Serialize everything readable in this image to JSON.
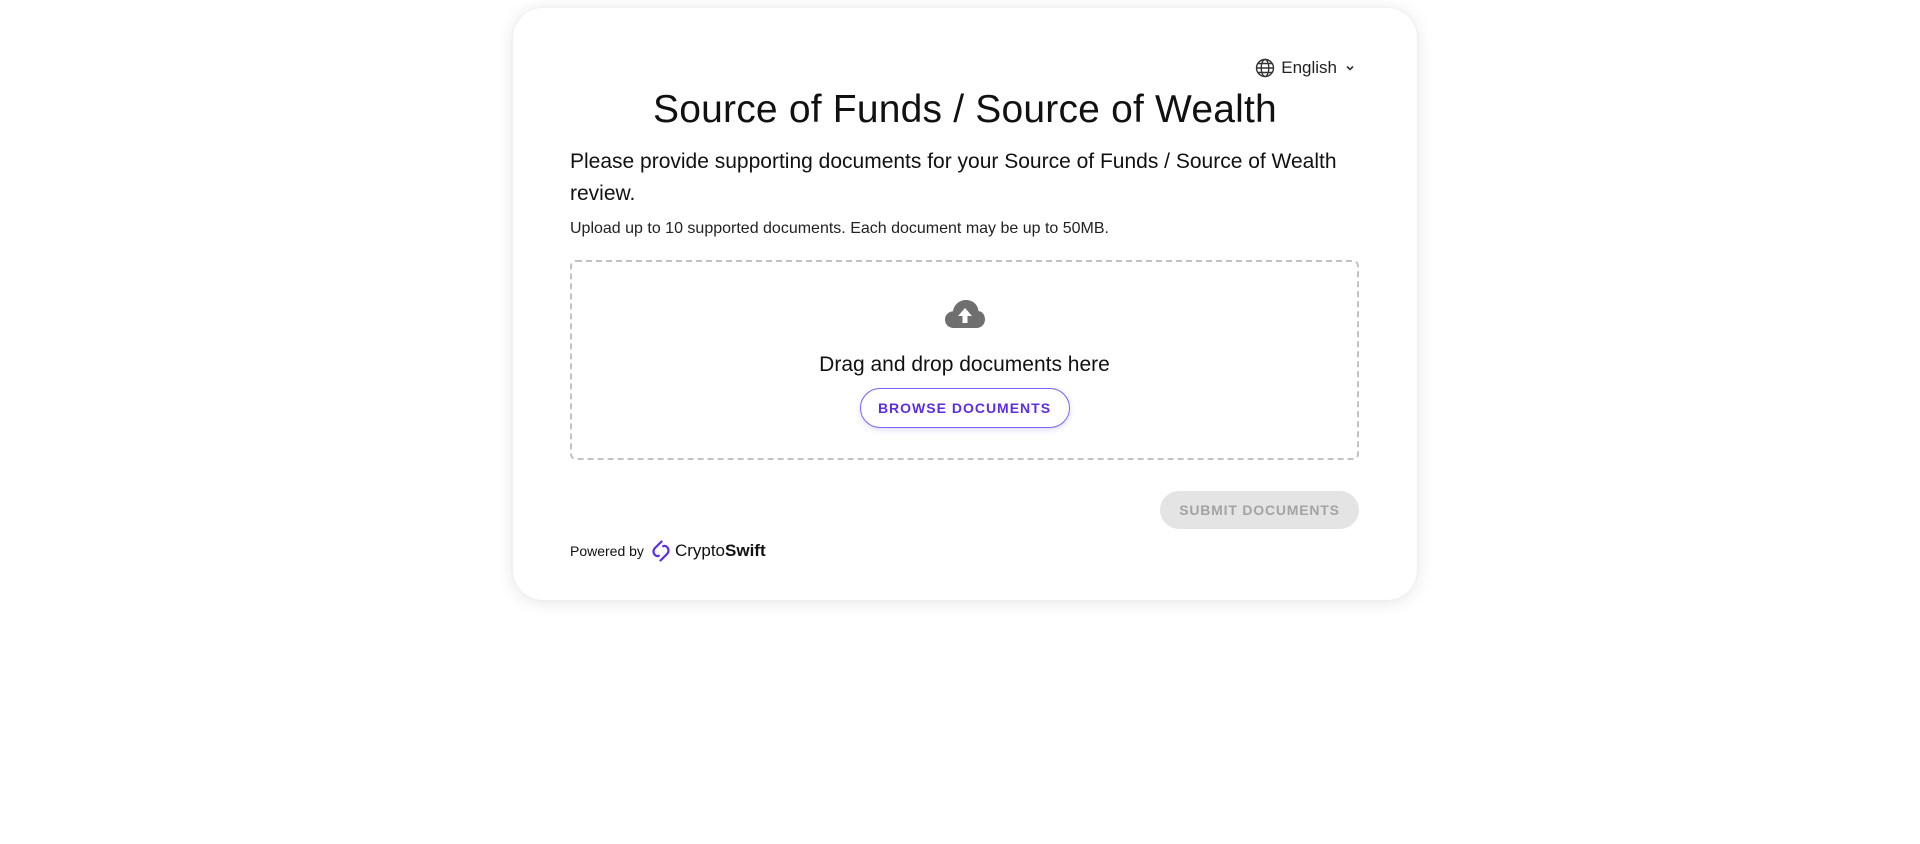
{
  "language": {
    "selected": "English",
    "icon": "globe-icon",
    "chevron_icon": "chevron-down-icon"
  },
  "page": {
    "title": "Source of Funds / Source of Wealth",
    "description": "Please provide supporting documents for your Source of Funds / Source of Wealth review.",
    "upload_hint": "Upload up to 10 supported documents. Each document may be up to 50MB."
  },
  "dropzone": {
    "icon": "cloud-upload-icon",
    "text": "Drag and drop documents here",
    "browse_label": "BROWSE DOCUMENTS"
  },
  "actions": {
    "submit_label": "SUBMIT DOCUMENTS",
    "submit_enabled": false
  },
  "footer": {
    "powered_by": "Powered by",
    "brand_logo": "cryptoswift-logo",
    "brand_name_part1": "Crypto",
    "brand_name_part2": "Swift"
  },
  "colors": {
    "accent": "#5b2ee6",
    "button_border": "#7b61ff",
    "disabled_bg": "#e4e4e4",
    "disabled_text": "#a3a3a3",
    "icon_gray": "#6f6f6f"
  }
}
